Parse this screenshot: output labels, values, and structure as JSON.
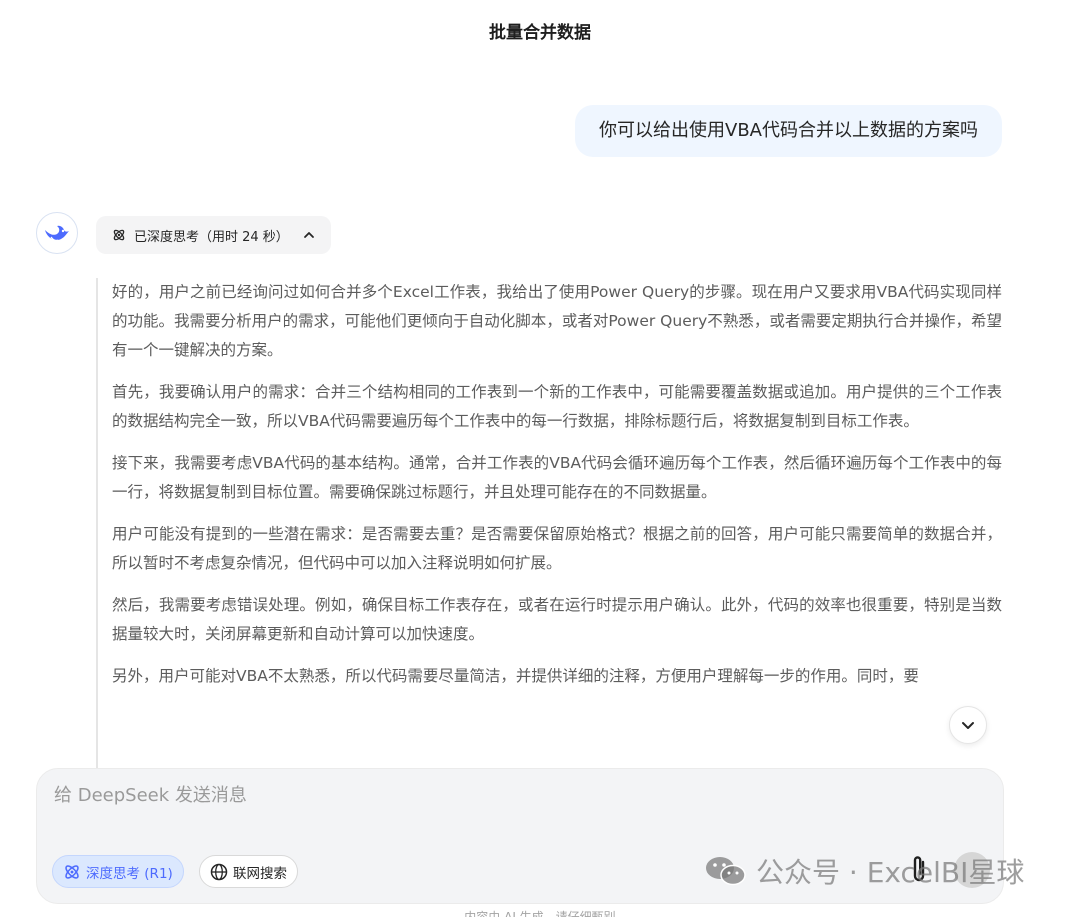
{
  "conversation": {
    "title": "批量合并数据"
  },
  "user_message": {
    "text": "你可以给出使用VBA代码合并以上数据的方案吗"
  },
  "assistant": {
    "think_chip_label": "已深度思考（用时 24 秒）",
    "reasoning": [
      "好的，用户之前已经询问过如何合并多个Excel工作表，我给出了使用Power Query的步骤。现在用户又要求用VBA代码实现同样的功能。我需要分析用户的需求，可能他们更倾向于自动化脚本，或者对Power Query不熟悉，或者需要定期执行合并操作，希望有一个一键解决的方案。",
      "首先，我要确认用户的需求：合并三个结构相同的工作表到一个新的工作表中，可能需要覆盖数据或追加。用户提供的三个工作表的数据结构完全一致，所以VBA代码需要遍历每个工作表中的每一行数据，排除标题行后，将数据复制到目标工作表。",
      "接下来，我需要考虑VBA代码的基本结构。通常，合并工作表的VBA代码会循环遍历每个工作表，然后循环遍历每个工作表中的每一行，将数据复制到目标位置。需要确保跳过标题行，并且处理可能存在的不同数据量。",
      "用户可能没有提到的一些潜在需求：是否需要去重？是否需要保留原始格式？根据之前的回答，用户可能只需要简单的数据合并，所以暂时不考虑复杂情况，但代码中可以加入注释说明如何扩展。",
      "然后，我需要考虑错误处理。例如，确保目标工作表存在，或者在运行时提示用户确认。此外，代码的效率也很重要，特别是当数据量较大时，关闭屏幕更新和自动计算可以加快速度。",
      "另外，用户可能对VBA不太熟悉，所以代码需要尽量简洁，并提供详细的注释，方便用户理解每一步的作用。同时，要"
    ]
  },
  "composer": {
    "placeholder": "给 DeepSeek 发送消息",
    "deep_think_label": "深度思考 (R1)",
    "web_search_label": "联网搜索"
  },
  "watermark": {
    "text": "公众号 · ExcelBI星球"
  },
  "footer": {
    "note": "内容由 AI 生成，请仔细甄别"
  },
  "colors": {
    "accent": "#4d6bfe",
    "user_bubble": "#eff6ff",
    "composer_bg": "#f3f4f6"
  },
  "icons": [
    "deepseek-whale-icon",
    "atom-icon",
    "chevron-up-icon",
    "chevron-down-icon",
    "globe-icon",
    "paperclip-icon",
    "wechat-icon"
  ]
}
